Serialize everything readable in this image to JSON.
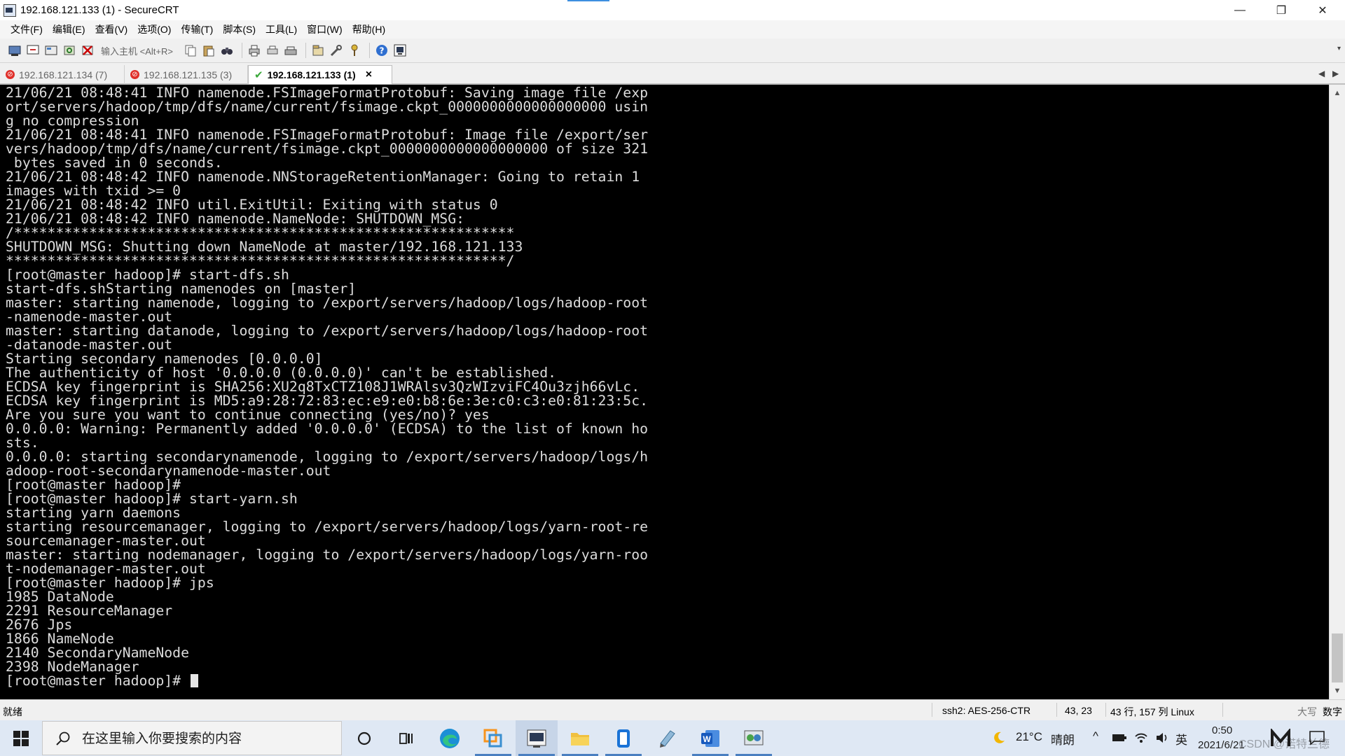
{
  "window": {
    "title": "192.168.121.133 (1) - SecureCRT",
    "minimize": "—",
    "maximize": "❐",
    "close": "✕"
  },
  "menu": [
    "文件(F)",
    "编辑(E)",
    "查看(V)",
    "选项(O)",
    "传输(T)",
    "脚本(S)",
    "工具(L)",
    "窗口(W)",
    "帮助(H)"
  ],
  "toolbar": {
    "host_input_label": "输入主机 <Alt+R>"
  },
  "tabs": [
    {
      "label": "192.168.121.134 (7)",
      "status": "error",
      "active": false
    },
    {
      "label": "192.168.121.135 (3)",
      "status": "error",
      "active": false
    },
    {
      "label": "192.168.121.133 (1)",
      "status": "connected",
      "active": true
    }
  ],
  "terminal": {
    "lines": [
      "21/06/21 08:48:41 INFO namenode.FSImageFormatProtobuf: Saving image file /exp",
      "ort/servers/hadoop/tmp/dfs/name/current/fsimage.ckpt_0000000000000000000 usin",
      "g no compression",
      "21/06/21 08:48:41 INFO namenode.FSImageFormatProtobuf: Image file /export/ser",
      "vers/hadoop/tmp/dfs/name/current/fsimage.ckpt_0000000000000000000 of size 321",
      " bytes saved in 0 seconds.",
      "21/06/21 08:48:42 INFO namenode.NNStorageRetentionManager: Going to retain 1",
      "images with txid >= 0",
      "21/06/21 08:48:42 INFO util.ExitUtil: Exiting with status 0",
      "21/06/21 08:48:42 INFO namenode.NameNode: SHUTDOWN_MSG:",
      "/************************************************************",
      "SHUTDOWN_MSG: Shutting down NameNode at master/192.168.121.133",
      "************************************************************/",
      "[root@master hadoop]# start-dfs.sh",
      "start-dfs.shStarting namenodes on [master]",
      "master: starting namenode, logging to /export/servers/hadoop/logs/hadoop-root",
      "-namenode-master.out",
      "master: starting datanode, logging to /export/servers/hadoop/logs/hadoop-root",
      "-datanode-master.out",
      "Starting secondary namenodes [0.0.0.0]",
      "The authenticity of host '0.0.0.0 (0.0.0.0)' can't be established.",
      "ECDSA key fingerprint is SHA256:XU2q8TxCTZ108J1WRAlsv3QzWIzviFC4Ou3zjh66vLc.",
      "ECDSA key fingerprint is MD5:a9:28:72:83:ec:e9:e0:b8:6e:3e:c0:c3:e0:81:23:5c.",
      "Are you sure you want to continue connecting (yes/no)? yes",
      "0.0.0.0: Warning: Permanently added '0.0.0.0' (ECDSA) to the list of known ho",
      "sts.",
      "0.0.0.0: starting secondarynamenode, logging to /export/servers/hadoop/logs/h",
      "adoop-root-secondarynamenode-master.out",
      "[root@master hadoop]#",
      "[root@master hadoop]# start-yarn.sh",
      "starting yarn daemons",
      "starting resourcemanager, logging to /export/servers/hadoop/logs/yarn-root-re",
      "sourcemanager-master.out",
      "master: starting nodemanager, logging to /export/servers/hadoop/logs/yarn-roo",
      "t-nodemanager-master.out",
      "[root@master hadoop]# jps",
      "1985 DataNode",
      "2291 ResourceManager",
      "2676 Jps",
      "1866 NameNode",
      "2140 SecondaryNameNode",
      "2398 NodeManager"
    ],
    "prompt": "[root@master hadoop]# "
  },
  "statusbar": {
    "ready": "就绪",
    "cipher": "ssh2: AES-256-CTR",
    "cursor_pos": "43,  23",
    "rows_cols": "43 行, 157 列 Linux",
    "caps": "大写",
    "num": "数字"
  },
  "taskbar": {
    "search_placeholder": "在这里输入你要搜索的内容",
    "weather_temp": "21°C",
    "weather_text": "晴朗",
    "ime": "英",
    "time": "0:50",
    "date": "2021/6/21",
    "watermark": "CSDN @诺特兰德"
  },
  "colors": {
    "terminal_bg": "#000000",
    "terminal_fg": "#dcdcdc",
    "taskbar_bg": "#dfe8f4",
    "error_red": "#e0302a",
    "ok_green": "#3aa83a"
  }
}
